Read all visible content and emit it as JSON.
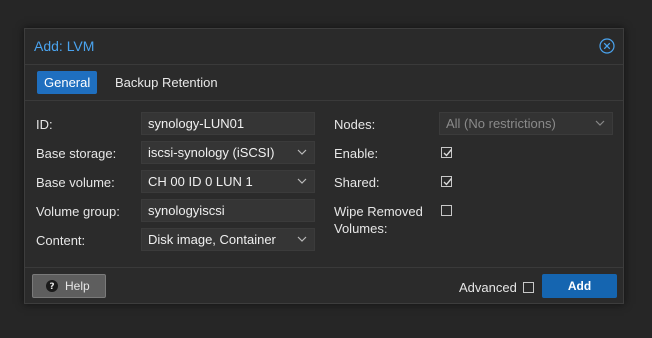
{
  "dialog": {
    "title": "Add: LVM",
    "title_color": "#4aa3ee",
    "close_icon": "close-circle-icon"
  },
  "tabs": [
    {
      "label": "General",
      "active": true
    },
    {
      "label": "Backup Retention",
      "active": false
    }
  ],
  "left": {
    "id": {
      "label": "ID:",
      "value": "synology-LUN01"
    },
    "base_storage": {
      "label": "Base storage:",
      "value": "iscsi-synology (iSCSI)"
    },
    "base_volume": {
      "label": "Base volume:",
      "value": "CH 00 ID 0 LUN 1"
    },
    "volume_group": {
      "label": "Volume group:",
      "value": "synologyiscsi"
    },
    "content": {
      "label": "Content:",
      "value": "Disk image, Container"
    }
  },
  "right": {
    "nodes": {
      "label": "Nodes:",
      "value": "All (No restrictions)",
      "disabled": true
    },
    "enable": {
      "label": "Enable:",
      "checked": true
    },
    "shared": {
      "label": "Shared:",
      "checked": true
    },
    "wipe": {
      "label_line1": "Wipe Removed",
      "label_line2": "Volumes:",
      "checked": false
    }
  },
  "footer": {
    "help_label": "Help",
    "help_icon": "question-circle-icon",
    "advanced_label": "Advanced",
    "advanced_checked": false,
    "add_label": "Add",
    "accent_color": "#1565b0"
  }
}
